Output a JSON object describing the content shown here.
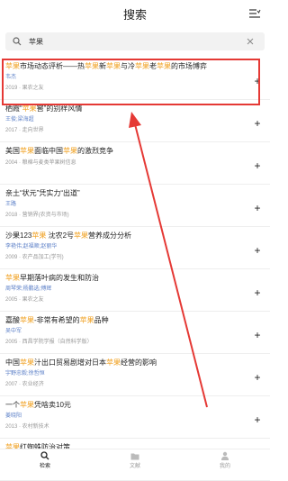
{
  "header": {
    "title": "搜索"
  },
  "search": {
    "query": "苹果"
  },
  "results": [
    {
      "title": [
        "",
        "苹果",
        "市场动态评析——热",
        "苹果",
        "新",
        "苹果",
        "与冷",
        "苹果",
        "老",
        "苹果",
        "的市场博弈"
      ],
      "author": "韦杰",
      "source": "2019 · 果农之友"
    },
    {
      "title": [
        "栖霞“",
        "苹果",
        "窖”的别样风情"
      ],
      "author": "王俊;梁海超",
      "source": "2017 · 走向世界"
    },
    {
      "title": [
        "美国",
        "苹果",
        "面临中国",
        "苹果",
        "的激烈竞争"
      ],
      "author": "",
      "source": "2004 · 粮棉与麦类苹果树信息"
    },
    {
      "title": [
        "亲土“状元”凭实力“出道”"
      ],
      "author": "王路",
      "source": "2018 · 营销界(农资与市场)"
    },
    {
      "title": [
        "沙果123",
        "苹果",
        "  沈农2号",
        "苹果",
        "营养成分分析"
      ],
      "author": "李艳伟;赵福顺;赵丽华",
      "source": "2009 · 农产品加工(学刊)"
    },
    {
      "title": [
        "",
        "苹果",
        "早期落叶病的发生和防治"
      ],
      "author": "周琴荣;杨鹏选;傅辉",
      "source": "2005 · 果农之友"
    },
    {
      "title": [
        "嘉酸",
        "苹果",
        "-非常有希望的",
        "苹果",
        "品种"
      ],
      "author": "吴中军",
      "source": "2005 · 西昌学院学报（自然科学版）"
    },
    {
      "title": [
        "中国",
        "苹果",
        "汁出口贸易剧增对日本",
        "苹果",
        "经营的影响"
      ],
      "author": "宇野忠毅;徐哲恒",
      "source": "2007 · 农业经济"
    },
    {
      "title": [
        "一个",
        "苹果",
        "凭啥卖10元"
      ],
      "author": "姜晓阳",
      "source": "2013 · 农村新技术"
    },
    {
      "title": [
        "",
        "苹果",
        "红蜘蛛防治对策"
      ],
      "author": "",
      "source": ""
    }
  ],
  "tabs": [
    {
      "label": "检索",
      "icon": "search-icon"
    },
    {
      "label": "文献",
      "icon": "folder-icon"
    },
    {
      "label": "我的",
      "icon": "person-icon"
    }
  ],
  "colors": {
    "highlight": "#f0a020",
    "annotation": "#e53935",
    "author": "#5b7fc7"
  }
}
